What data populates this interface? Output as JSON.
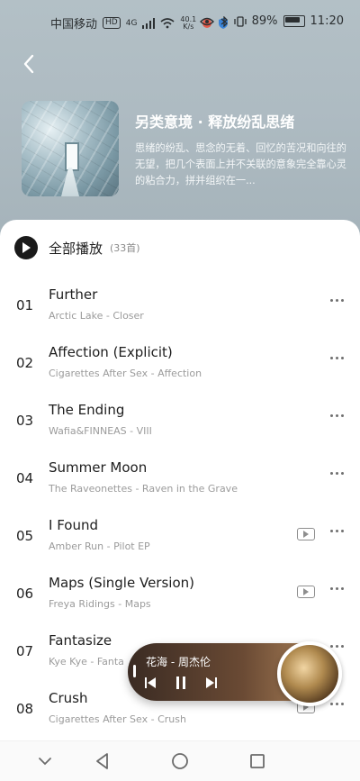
{
  "status": {
    "carrier": "中国移动",
    "hd": "HD",
    "network": "4G",
    "speed": "40.1\nK/s",
    "battery": "89%",
    "time": "11:20"
  },
  "header": {
    "title": "另类意境 · 释放纷乱思绪",
    "description": "思绪的纷乱、思念的无着、回忆的苦况和向往的无望，把几个表面上并不关联的意象完全靠心灵的粘合力，拼并组织在一..."
  },
  "play_all": {
    "label": "全部播放",
    "count": "(33首)"
  },
  "tracks": [
    {
      "no": "01",
      "title": "Further",
      "sub": "Arctic Lake - Closer",
      "mv": false
    },
    {
      "no": "02",
      "title": "Affection (Explicit)",
      "sub": "Cigarettes After Sex - Affection",
      "mv": false
    },
    {
      "no": "03",
      "title": "The Ending",
      "sub": "Wafia&FINNEAS - VIII",
      "mv": false
    },
    {
      "no": "04",
      "title": "Summer Moon",
      "sub": "The Raveonettes - Raven in the Grave",
      "mv": false
    },
    {
      "no": "05",
      "title": "I Found",
      "sub": "Amber Run - Pilot EP",
      "mv": true
    },
    {
      "no": "06",
      "title": "Maps (Single Version)",
      "sub": "Freya Ridings - Maps",
      "mv": true
    },
    {
      "no": "07",
      "title": "Fantasize",
      "sub": "Kye Kye - Fanta",
      "mv": false
    },
    {
      "no": "08",
      "title": "Crush",
      "sub": "Cigarettes After Sex - Crush",
      "mv": true
    }
  ],
  "mini_player": {
    "now_playing": "花海 - 周杰伦"
  },
  "colors": {
    "header_bg": "#aebbc2",
    "card_bg": "#ffffff",
    "player_bg": "#6a4a34"
  }
}
